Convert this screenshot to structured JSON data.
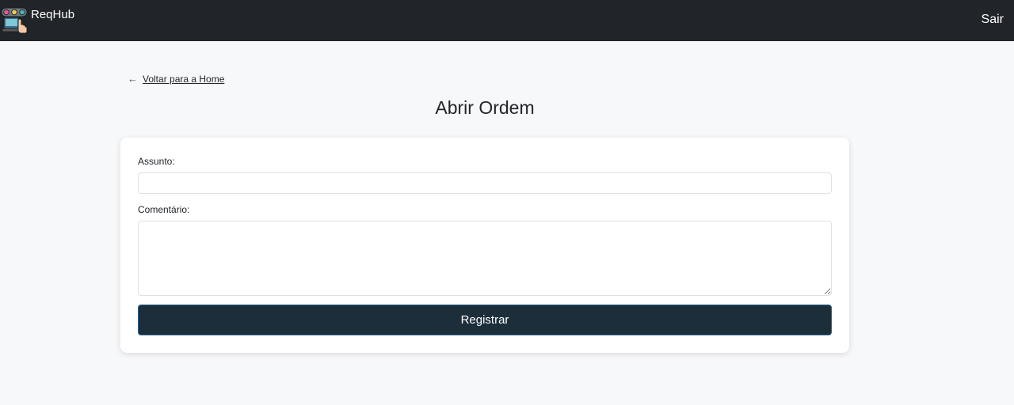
{
  "navbar": {
    "brand_name": "ReqHub",
    "logo_icon": "robot-logo-icon",
    "exit_label": "Sair",
    "background_color": "#212529"
  },
  "back_link": {
    "arrow_icon": "arrow-left-icon",
    "label": "Voltar para a Home"
  },
  "page": {
    "title": "Abrir Ordem"
  },
  "form": {
    "subject_label": "Assunto:",
    "subject_value": "",
    "comment_label": "Comentário:",
    "comment_value": "",
    "submit_label": "Registrar",
    "submit_color": "#1c2e3a"
  }
}
